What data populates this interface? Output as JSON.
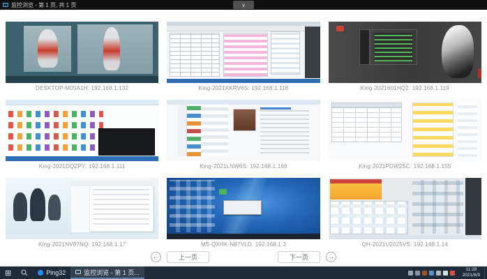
{
  "window": {
    "title": "监控浏览 - 第 1 页, 共 1 页",
    "dropdown_icon": "∨"
  },
  "grid": {
    "thumbnails": [
      {
        "caption": "DESKTOP-M05A1H: 192.168.1.132"
      },
      {
        "caption": "King-2021AKRV6S: 192.168.1.116"
      },
      {
        "caption": "King-2021601HQ2: 192.168.1.119"
      },
      {
        "caption": "King-2021DQZPY: 192.168.1.111"
      },
      {
        "caption": "King-2021LNW6S: 192.168.1.166"
      },
      {
        "caption": "King-2021PDW2SC: 192.168.1.155"
      },
      {
        "caption": "King-2021NV87NQ: 192.168.1.17"
      },
      {
        "caption": "MS-QXHK-N87VLD: 192.168.1.3"
      },
      {
        "caption": "QH-2021U2025VS: 192.168.1.14"
      }
    ]
  },
  "pagination": {
    "prev_arrow": "←",
    "prev_label": "上一页",
    "next_label": "下一页",
    "next_arrow": "→"
  },
  "taskbar": {
    "start_icon": "⊞",
    "pinned_app_label": "Ping32",
    "active_app_label": "监控浏览 - 第 1 页...",
    "clock_time": "11:28",
    "clock_date": "2021/6/9"
  },
  "colors": {
    "accent_blue": "#2d8cf0",
    "taskbar_bg": "#1e2c3a",
    "titlebar_bg": "#101010"
  }
}
